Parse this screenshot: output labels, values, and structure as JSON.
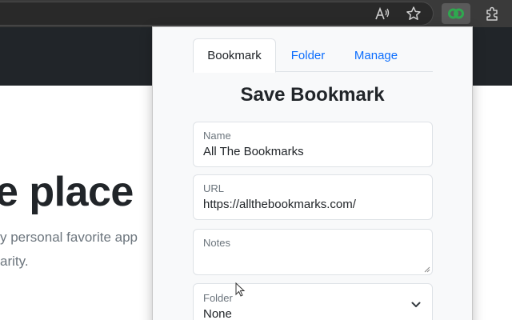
{
  "browser": {
    "icons": [
      "read-aloud-icon",
      "favorites-star-icon",
      "extension-active-icon",
      "extensions-puzzle-icon"
    ]
  },
  "page": {
    "hero_title": "e place",
    "hero_line1": "y personal favorite app",
    "hero_line2": "arity."
  },
  "popup": {
    "tabs": [
      {
        "label": "Bookmark",
        "active": true
      },
      {
        "label": "Folder",
        "active": false
      },
      {
        "label": "Manage",
        "active": false
      }
    ],
    "title": "Save Bookmark",
    "fields": {
      "name": {
        "label": "Name",
        "value": "All The Bookmarks"
      },
      "url": {
        "label": "URL",
        "value": "https://allthebookmarks.com/"
      },
      "notes": {
        "label": "Notes",
        "value": ""
      },
      "folder": {
        "label": "Folder",
        "value": "None"
      }
    }
  },
  "colors": {
    "accent": "#0d6efd",
    "page_header": "#212529",
    "toolbar": "#3a3a3a",
    "extension_green": "#2fa84f"
  }
}
